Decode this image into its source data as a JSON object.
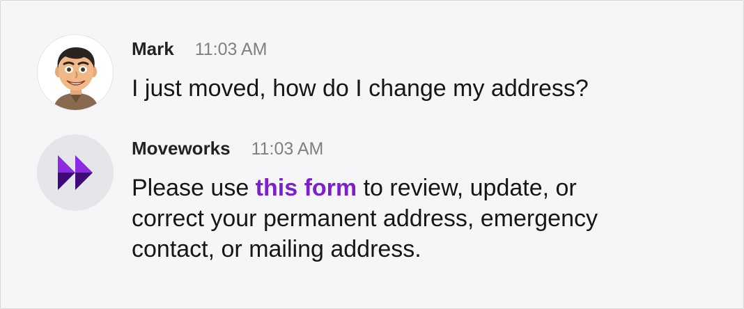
{
  "messages": [
    {
      "author": "Mark",
      "time": "11:03 AM",
      "text": "I just moved, how do I change my address?"
    },
    {
      "author": "Moveworks",
      "time": "11:03 AM",
      "text_before": "Please use ",
      "link": "this form",
      "line1_after": " to review, update, or",
      "line2": "correct your permanent address, emergency",
      "line3": "contact, or mailing address."
    }
  ],
  "colors": {
    "background": "#f6f5f7",
    "link": "#7a1fd1",
    "bot_logo": "#6a12c4",
    "timestamp": "#808080"
  },
  "icons": {
    "mark_avatar": "avatar",
    "bot_avatar": "moveworks-logo-icon"
  }
}
